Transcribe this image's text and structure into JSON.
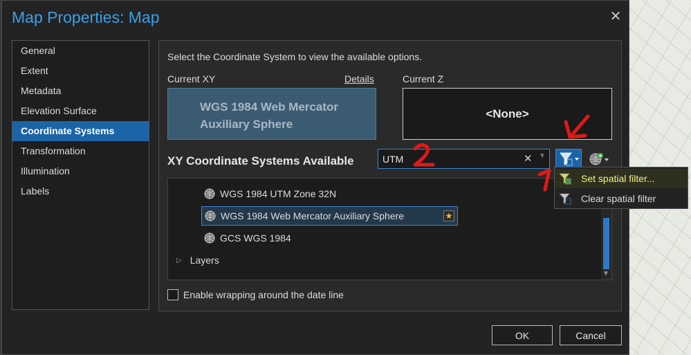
{
  "window": {
    "title": "Map Properties: Map",
    "close_glyph": "✕"
  },
  "nav": {
    "items": [
      {
        "label": "General"
      },
      {
        "label": "Extent"
      },
      {
        "label": "Metadata"
      },
      {
        "label": "Elevation Surface"
      },
      {
        "label": "Coordinate Systems",
        "active": true
      },
      {
        "label": "Transformation"
      },
      {
        "label": "Illumination"
      },
      {
        "label": "Labels"
      }
    ]
  },
  "coord": {
    "instruction": "Select the Coordinate System to view the available options.",
    "current_xy_label": "Current XY",
    "details_link": "Details",
    "current_xy_value": "WGS 1984 Web Mercator Auxiliary Sphere",
    "current_z_label": "Current Z",
    "current_z_value": "<None>",
    "available_title": "XY Coordinate Systems Available",
    "search_value": "UTM",
    "search_clear_glyph": "✕",
    "tree": {
      "rows": [
        {
          "label": "WGS 1984 UTM Zone 32N",
          "icon": "globe-icon"
        },
        {
          "label": "WGS 1984 Web Mercator Auxiliary Sphere",
          "icon": "globe-icon",
          "selected": true,
          "favorite_icon": "star-icon"
        },
        {
          "label": "GCS WGS 1984",
          "icon": "globe-icon"
        },
        {
          "label": "Layers",
          "icon": "expand-caret-icon"
        }
      ]
    },
    "wrap_label": "Enable wrapping around the date line",
    "wrap_checked": false
  },
  "buttons": {
    "ok": "OK",
    "cancel": "Cancel"
  },
  "filter_menu": {
    "items": [
      {
        "label": "Set spatial filter...",
        "icon": "set-spatial-filter-icon",
        "highlighted": true
      },
      {
        "label": "Clear spatial filter",
        "icon": "clear-spatial-filter-icon"
      }
    ]
  },
  "annotations": {
    "num1": "1",
    "num2": "2"
  },
  "colors": {
    "accent": "#1c64a8",
    "title": "#3aa0e6",
    "annotation": "#e01919",
    "menu_highlight_text": "#f3f08c"
  }
}
